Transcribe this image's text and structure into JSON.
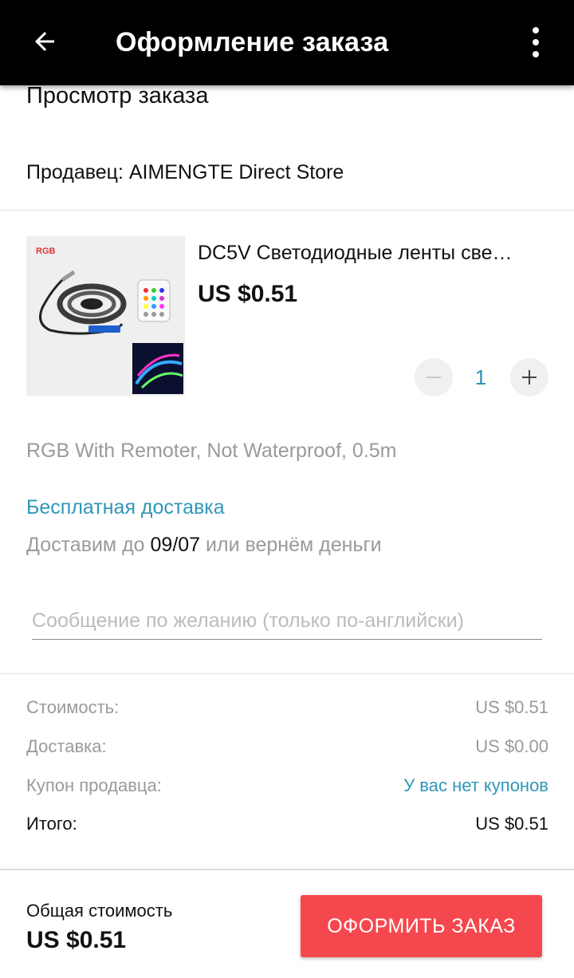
{
  "appbar": {
    "title": "Оформление заказа",
    "back_icon": "arrow-left-icon",
    "menu_icon": "more-vertical-icon"
  },
  "order": {
    "section_title": "Просмотр заказа",
    "seller": "Продавец: AIMENGTE Direct Store"
  },
  "product": {
    "name": "DC5V Светодиодные ленты све…",
    "price": "US $0.51",
    "quantity": "1",
    "image_label": "RGB",
    "variant": "RGB With Remoter, Not Waterproof, 0.5m"
  },
  "shipping": {
    "method": "Бесплатная доставка",
    "delivery_prefix": "Доставим до ",
    "delivery_date": "09/07",
    "delivery_suffix": " или вернём деньги"
  },
  "message": {
    "placeholder": "Сообщение по желанию (только по-английски)",
    "value": ""
  },
  "summary": {
    "rows": [
      {
        "label": "Стоимость:",
        "value": "US $0.51"
      },
      {
        "label": "Доставка:",
        "value": "US $0.00"
      },
      {
        "label": "Купон продавца:",
        "value": "У вас нет купонов"
      },
      {
        "label": "Итого:",
        "value": "US $0.51"
      }
    ]
  },
  "footer": {
    "total_label": "Общая стоимость",
    "total_value": "US $0.51",
    "order_button": "ОФОРМИТЬ ЗАКАЗ"
  },
  "colors": {
    "appbar": "#000000",
    "accent_link": "#2f97b8",
    "order_button": "#f5484e",
    "muted_text": "#9a9a9a"
  }
}
